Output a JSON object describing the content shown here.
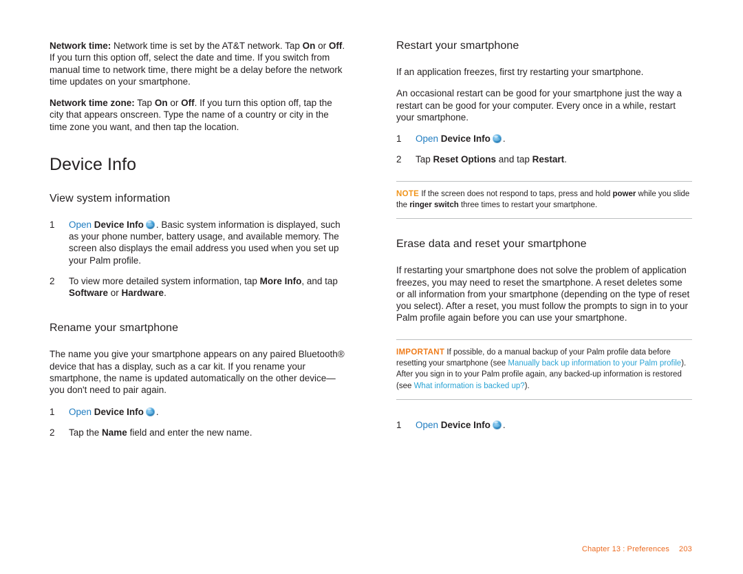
{
  "document": {
    "left_column": {
      "intro_paragraphs": [
        {
          "lead": "Network time:",
          "text_1": " Network time is set by the AT&T network. Tap ",
          "b1": "On",
          "text_2": " or ",
          "b2": "Off",
          "text_3": ". If you turn this option off, select the date and time. If you switch from manual time to network time, there might be a delay before the network time updates on your smartphone."
        },
        {
          "lead": "Network time zone:",
          "text_1": " Tap ",
          "b1": "On",
          "text_2": " or ",
          "b2": "Off",
          "text_3": ". If you turn this option off, tap the city that appears onscreen. Type the name of a country or city in the time zone you want, and then tap the location."
        }
      ],
      "chapter_title": "Device Info",
      "section_1": {
        "title": "View system information",
        "steps": [
          {
            "num": "1",
            "open_label": "Open",
            "app_label": "Device Info",
            "icon": "palm-app-globe-icon",
            "text": ". Basic system information is displayed, such as your phone number, battery usage, and available memory. The screen also displays the email address you used when you set up your Palm profile."
          },
          {
            "num": "2",
            "text_1": "To view more detailed system information, tap ",
            "b1": "More Info",
            "text_2": ", and tap ",
            "b2": "Software",
            "text_3": " or ",
            "b3": "Hardware",
            "text_4": "."
          }
        ]
      },
      "section_2": {
        "title": "Rename your smartphone",
        "paragraph": "The name you give your smartphone appears on any paired Bluetooth® device that has a display, such as a car kit. If you rename your smartphone, the name is updated automatically on the other device—you don't need to pair again.",
        "steps": [
          {
            "num": "1",
            "open_label": "Open",
            "app_label": "Device Info",
            "icon": "palm-app-globe-icon",
            "text": "."
          },
          {
            "num": "2",
            "text_1": "Tap the ",
            "b1": "Name",
            "text_2": " field and enter the new name."
          }
        ]
      }
    },
    "right_column": {
      "section_1": {
        "title": "Restart your smartphone",
        "paragraph_1": "If an application freezes, first try restarting your smartphone.",
        "paragraph_2": "An occasional restart can be good for your smartphone just the way a restart can be good for your computer. Every once in a while, restart your smartphone.",
        "steps": [
          {
            "num": "1",
            "open_label": "Open",
            "app_label": "Device Info",
            "icon": "palm-app-globe-icon",
            "text": "."
          },
          {
            "num": "2",
            "text_1": "Tap ",
            "b1": "Reset Options",
            "text_2": " and tap ",
            "b2": "Restart",
            "text_3": "."
          }
        ],
        "note": {
          "label": "NOTE",
          "text_1": " If the screen does not respond to taps, press and hold ",
          "b1": "power",
          "text_2": " while you slide the ",
          "b2": "ringer switch",
          "text_3": " three times to restart your smartphone."
        }
      },
      "section_2": {
        "title": "Erase data and reset your smartphone",
        "paragraph": "If restarting your smartphone does not solve the problem of application freezes, you may need to reset the smartphone. A reset deletes some or all information from your smartphone (depending on the type of reset you select). After a reset, you must follow the prompts to sign in to your Palm profile again before you can use your smartphone.",
        "important": {
          "label": "IMPORTANT",
          "text_1": " If possible, do a manual backup of your Palm profile data before resetting your smartphone (see ",
          "link_1": "Manually back up information to your Palm profile",
          "text_2": "). After you sign in to your Palm profile again, any backed-up information is restored (see ",
          "link_2": "What information is backed up?",
          "text_3": ")."
        },
        "steps": [
          {
            "num": "1",
            "open_label": "Open",
            "app_label": "Device Info",
            "icon": "palm-app-globe-icon",
            "text": "."
          }
        ]
      }
    },
    "footer": {
      "chapter": "Chapter 13",
      "separator": ":",
      "section": "Preferences",
      "page_number": "203"
    }
  },
  "colors": {
    "accent_orange": "#ec6a1f",
    "note_orange": "#f0941b",
    "link_blue": "#1f7cc0",
    "xref_blue": "#29a3d4",
    "text": "#231f20",
    "rule": "#bcbec0"
  }
}
